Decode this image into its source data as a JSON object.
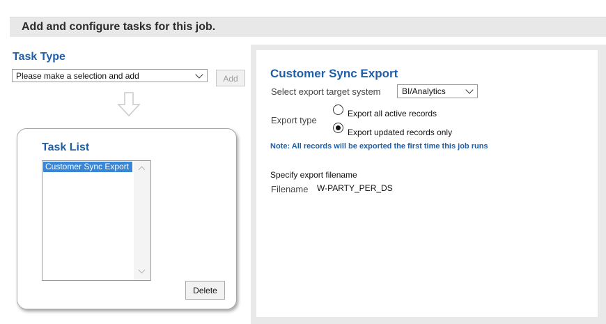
{
  "header": {
    "title": "Add and configure tasks for this job."
  },
  "task_type": {
    "title": "Task Type",
    "select_value": "Please make a selection and add",
    "add_label": "Add"
  },
  "task_list": {
    "title": "Task List",
    "items": [
      "Customer Sync Export"
    ],
    "delete_label": "Delete"
  },
  "config": {
    "title": "Customer Sync Export",
    "target_label": "Select export target system",
    "target_value": "BI/Analytics",
    "export_type_label": "Export type",
    "options": [
      {
        "label": "Export all active records",
        "selected": false
      },
      {
        "label": "Export updated records only",
        "selected": true
      }
    ],
    "note": "Note: All records will be exported the first time this job runs",
    "filename_heading": "Specify export filename",
    "filename_label": "Filename",
    "filename_value": "W-PARTY_PER_DS"
  },
  "icons": [
    "down-arrow-icon",
    "chevron-down-icon",
    "scroll-up-icon",
    "scroll-down-icon",
    "radio-icon"
  ],
  "colors": {
    "accent": "#1f5ea8",
    "selection": "#3a86d6",
    "panel_bg": "#e9e9e9"
  }
}
